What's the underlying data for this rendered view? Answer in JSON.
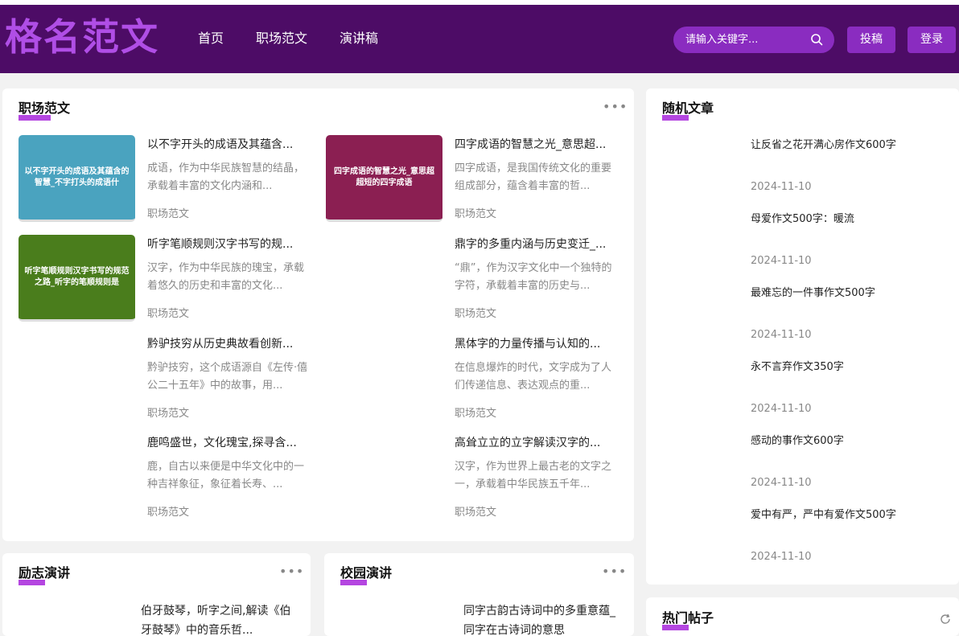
{
  "header": {
    "logo": "格名范文",
    "nav": [
      "首页",
      "职场范文",
      "演讲稿"
    ],
    "search_placeholder": "请输入关键字...",
    "submit_label": "投稿",
    "login_label": "登录",
    "accent": "#8a2cc0",
    "bg": "#4d0c66"
  },
  "main": {
    "title": "职场范文",
    "articles": [
      {
        "title": "以不字开头的成语及其蕴含...",
        "summary": "成语，作为中华民族智慧的结晶，承载着丰富的文化内涵和...",
        "category": "职场范文",
        "thumb_text": "以不字开头的成语及其蕴含的智慧_不字打头的成语什",
        "thumb_color": "#4aa3bf"
      },
      {
        "title": "四字成语的智慧之光_意思超...",
        "summary": "四字成语，是我国传统文化的重要组成部分，蕴含着丰富的哲...",
        "category": "职场范文",
        "thumb_text": "四字成语的智慧之光_意思超超短的四字成语",
        "thumb_color": "#8b1f52"
      },
      {
        "title": "听字笔顺规则汉字书写的规...",
        "summary": "汉字，作为中华民族的瑰宝，承载着悠久的历史和丰富的文化...",
        "category": "职场范文",
        "thumb_text": "听字笔顺规则汉字书写的规范之路_听字的笔顺规则是",
        "thumb_color": "#4a7d1c"
      },
      {
        "title": "鼎字的多重内涵与历史变迁_...",
        "summary": "“鼎”，作为汉字文化中一个独特的字符，承载着丰富的历史与...",
        "category": "职场范文"
      },
      {
        "title": "黔驴技穷从历史典故看创新...",
        "summary": "黔驴技穷，这个成语源自《左传·僖公二十五年》中的故事，用...",
        "category": "职场范文"
      },
      {
        "title": "黑体字的力量传播与认知的...",
        "summary": "在信息爆炸的时代，文字成为了人们传递信息、表达观点的重...",
        "category": "职场范文"
      },
      {
        "title": "鹿鸣盛世，文化瑰宝,探寻含...",
        "summary": "鹿，自古以来便是中华文化中的一种吉祥象征，象征着长寿、...",
        "category": "职场范文"
      },
      {
        "title": "高耸立立的立字解读汉字的...",
        "summary": "汉字，作为世界上最古老的文字之一，承载着中华民族五千年...",
        "category": "职场范文"
      }
    ]
  },
  "random": {
    "title": "随机文章",
    "items": [
      {
        "title": "让反省之花开满心房作文600字",
        "date": "2024-11-10"
      },
      {
        "title": "母爱作文500字：暖流",
        "date": "2024-11-10"
      },
      {
        "title": "最难忘的一件事作文500字",
        "date": "2024-11-10"
      },
      {
        "title": "永不言弃作文350字",
        "date": "2024-11-10"
      },
      {
        "title": "感动的事作文600字",
        "date": "2024-11-10"
      },
      {
        "title": "爱中有严，严中有爱作文500字",
        "date": "2024-11-10"
      }
    ]
  },
  "inspire": {
    "title": "励志演讲",
    "first_title": "伯牙鼓琴，听字之间,解读《伯牙鼓琴》中的音乐哲..."
  },
  "campus": {
    "title": "校园演讲",
    "first_title": "同字古韵古诗词中的多重意蕴_同字在古诗词的意思"
  },
  "hot": {
    "title": "热门帖子"
  }
}
